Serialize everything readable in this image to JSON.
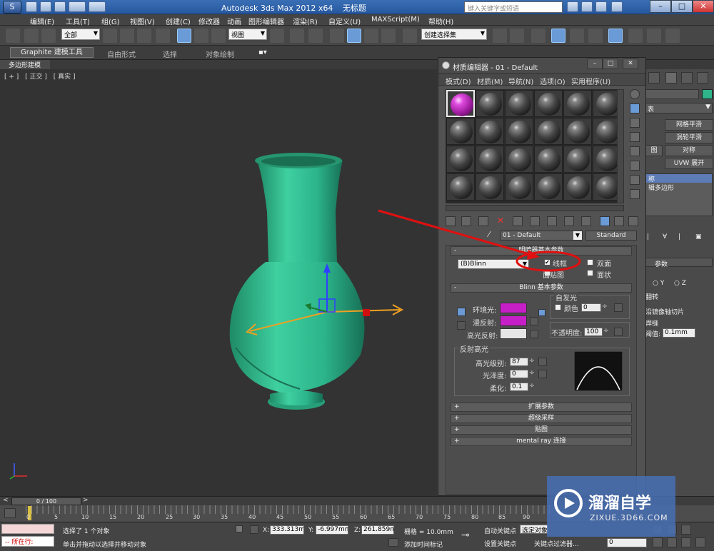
{
  "window": {
    "title_parts": [
      "Autodesk 3ds Max  2012 x64",
      "无标题"
    ],
    "search_placeholder": "键入关键字或短语",
    "controls": [
      "–",
      "□",
      "✕"
    ]
  },
  "menu": [
    "编辑(E)",
    "工具(T)",
    "组(G)",
    "视图(V)",
    "创建(C)",
    "修改器",
    "动画",
    "图形编辑器",
    "渲染(R)",
    "自定义(U)",
    "MAXScript(M)",
    "帮助(H)"
  ],
  "toolbar": {
    "selection_filter": "全部",
    "ref_coord": "视图",
    "named_selection": "创建选择集"
  },
  "ribbon": {
    "tabs": [
      "Graphite 建模工具",
      "自由形式",
      "选择",
      "对象绘制"
    ],
    "sub_label": "多边形建模"
  },
  "viewport": {
    "labels": [
      "[ + ]",
      "[ 正交 ]",
      "[ 真实 ]"
    ]
  },
  "right_panel": {
    "buttons": [
      "网格平滑",
      "涡轮平滑",
      "对称",
      "UVW 展开"
    ],
    "left_labels": [
      "图",
      "对称"
    ],
    "stack_items": [
      "称",
      "辑多边形"
    ],
    "param_header": "参数",
    "axis_y": "Y",
    "axis_z": "Z",
    "flip_label": "翻转",
    "slice_label": "沿镜像轴切片",
    "weld_label": "焊缝",
    "threshold_label": "阈值:",
    "threshold_value": "0.1mm",
    "list_label": "表"
  },
  "material_editor": {
    "title": "材质编辑器 - 01 - Default",
    "menu": [
      "模式(D)",
      "材质(M)",
      "导航(N)",
      "选项(O)",
      "实用程序(U)"
    ],
    "material_name": "01 - Default",
    "material_type": "Standard",
    "shader_rollout": "明暗器基本参数",
    "shader_type": "(B)Blinn",
    "wire_label": "线框",
    "wire_checked": "✔",
    "two_sided_label": "双面",
    "face_map_label": "面贴图",
    "faceted_label": "面状",
    "blinn_rollout": "Blinn 基本参数",
    "self_illum_group": "自发光",
    "color_label": "颜色",
    "color_value": "0",
    "ambient_label": "环境光:",
    "diffuse_label": "漫反射:",
    "specular_label": "高光反射:",
    "opacity_label": "不透明度:",
    "opacity_value": "100",
    "specular_group": "反射高光",
    "spec_level_label": "高光级别:",
    "spec_level_value": "87",
    "glossiness_label": "光泽度:",
    "glossiness_value": "0",
    "soften_label": "柔化:",
    "soften_value": "0.1",
    "rollouts": [
      "扩展参数",
      "超级采样",
      "贴图",
      "mental ray 连接"
    ],
    "ambient_color": "#c71fc7",
    "diffuse_color": "#c71fc7",
    "specular_color": "#e6e6e6"
  },
  "timeline": {
    "frame_display": "0 / 100",
    "ticks": [
      "0",
      "5",
      "10",
      "15",
      "20",
      "25",
      "30",
      "35",
      "40",
      "45",
      "50",
      "55",
      "60",
      "65",
      "70",
      "75",
      "80",
      "85",
      "90"
    ]
  },
  "status": {
    "running_label": "所在行:",
    "selection_msg": "选择了 1 个对象",
    "prompt_msg": "单击并拖动以选择并移动对象",
    "x_label": "X:",
    "x_value": "333.313mr",
    "y_label": "Y:",
    "y_value": "-6.997mm",
    "z_label": "Z:",
    "z_value": "261.859mr",
    "grid_label": "栅格 = 10.0mm",
    "add_time_tag": "添加时间标记",
    "auto_key": "自动关键点",
    "set_key": "设置关键点",
    "selected_dropdown": "选定对象",
    "key_filters": "关键点过滤器...",
    "frame_field": "0"
  },
  "watermark": {
    "title": "溜溜自学",
    "url": "ZIXUE.3D66.COM"
  },
  "colors": {
    "vase": "#2fb58a",
    "annotation_red": "#e01010",
    "gizmo_orange": "#f0a020"
  }
}
